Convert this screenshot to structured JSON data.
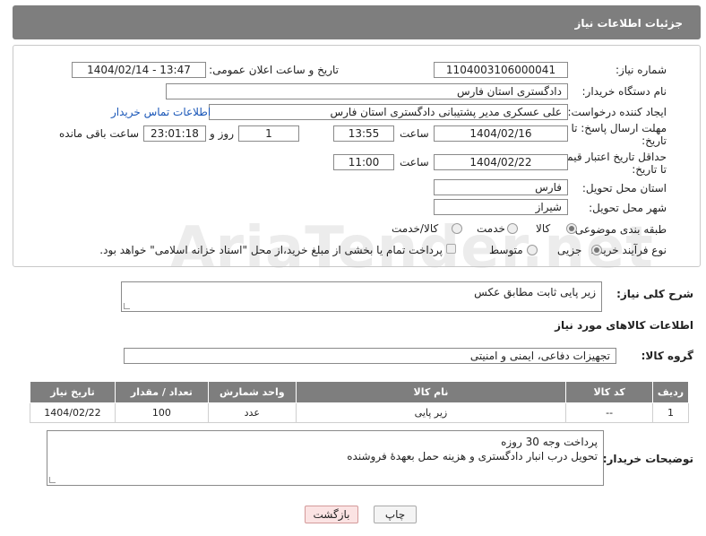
{
  "header": {
    "title": "جزئیات اطلاعات نیاز"
  },
  "form": {
    "need_number": {
      "label": "شماره نیاز:",
      "value": "1104003106000041"
    },
    "announce": {
      "label": "تاریخ و ساعت اعلان عمومی:",
      "value": "1404/02/14 - 13:47"
    },
    "buyer_org": {
      "label": "نام دستگاه خریدار:",
      "value": "دادگستری استان فارس"
    },
    "creator": {
      "label": "ایجاد کننده درخواست:",
      "value": "علی عسکری مدیر پشتیبانی دادگستری استان فارس",
      "contact_link": "اطلاعات تماس خریدار"
    },
    "reply_deadline": {
      "label_line1": "مهلت ارسال پاسخ: تا",
      "label_line2": "تاریخ:",
      "date": "1404/02/16",
      "time_label": "ساعت",
      "time": "13:55",
      "days": "1",
      "days_label": "روز و",
      "remaining": "23:01:18",
      "remaining_label": "ساعت باقی مانده"
    },
    "price_validity": {
      "label_line1": "حداقل تاریخ اعتبار قیمت:",
      "label_line2": "تا تاریخ:",
      "date": "1404/02/22",
      "time_label": "ساعت",
      "time": "11:00"
    },
    "delivery_province": {
      "label": "استان محل تحویل:",
      "value": "فارس"
    },
    "delivery_city": {
      "label": "شهر محل تحویل:",
      "value": "شیراز"
    },
    "category": {
      "label": "طبقه بندی موضوعی:",
      "options": [
        "کالا",
        "خدمت",
        "کالا/خدمت"
      ],
      "selected": 0
    },
    "process": {
      "label": "نوع فرآیند خرید :",
      "options": [
        "جزیی",
        "متوسط"
      ],
      "selected": 0,
      "note": "پرداخت تمام یا بخشی از مبلغ خرید،از محل \"اسناد خزانه اسلامی\" خواهد بود."
    }
  },
  "description": {
    "label": "شرح کلی نیاز:",
    "value": "زیر پایی ثابت مطابق عکس"
  },
  "goods_info": {
    "title": "اطلاعات کالاهای مورد نیاز"
  },
  "goods_group": {
    "label": "گروه کالا:",
    "value": "تجهیزات دفاعی، ایمنی و امنیتی"
  },
  "table": {
    "headers": [
      "ردیف",
      "کد کالا",
      "نام کالا",
      "واحد شمارش",
      "تعداد / مقدار",
      "تاریخ نیاز"
    ],
    "rows": [
      [
        "1",
        "--",
        "زیر پایی",
        "عدد",
        "100",
        "1404/02/22"
      ]
    ]
  },
  "buyer_notes": {
    "label": "توضیحات خریدار:",
    "line1": "پرداخت وجه 30 روزه",
    "line2": "تحویل درب انبار دادگستری و هزینه حمل بعهدهٔ فروشنده"
  },
  "buttons": {
    "print": "چاپ",
    "back": "بازگشت"
  },
  "watermark": {
    "text": "AriaTender.net"
  },
  "colors": {
    "header_bg": "#7e7e7e",
    "link": "#1a57b8",
    "back_button_bg": "#fbe3e3"
  }
}
